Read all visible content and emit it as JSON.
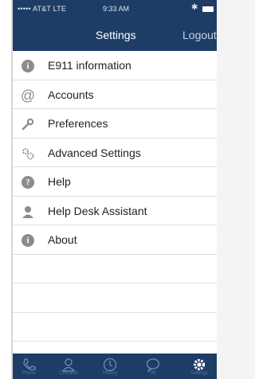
{
  "status_bar": {
    "carrier": "••••• AT&T  LTE",
    "time": "9:33 AM",
    "bluetooth_icon": "bluetooth-icon",
    "battery_icon": "battery-icon"
  },
  "navbar": {
    "title": "Settings",
    "logout_label": "Logout"
  },
  "menu": {
    "items": [
      {
        "label": "E911 information",
        "icon": "info-icon"
      },
      {
        "label": "Accounts",
        "icon": "at-icon"
      },
      {
        "label": "Preferences",
        "icon": "wrench-icon"
      },
      {
        "label": "Advanced Settings",
        "icon": "gears-icon"
      },
      {
        "label": "Help",
        "icon": "help-icon"
      },
      {
        "label": "Help Desk Assistant",
        "icon": "person-icon"
      },
      {
        "label": "About",
        "icon": "info-icon"
      }
    ]
  },
  "tabbar": {
    "tabs": [
      {
        "label": "Phone",
        "icon": "phone-icon"
      },
      {
        "label": "Contacts",
        "icon": "contacts-icon"
      },
      {
        "label": "History",
        "icon": "clock-icon"
      },
      {
        "label": "IM",
        "icon": "chat-icon"
      },
      {
        "label": "Settings",
        "icon": "gear-icon",
        "active": true
      }
    ]
  },
  "colors": {
    "header": "#1d3d66",
    "icon_gray": "#8c8c8c"
  }
}
